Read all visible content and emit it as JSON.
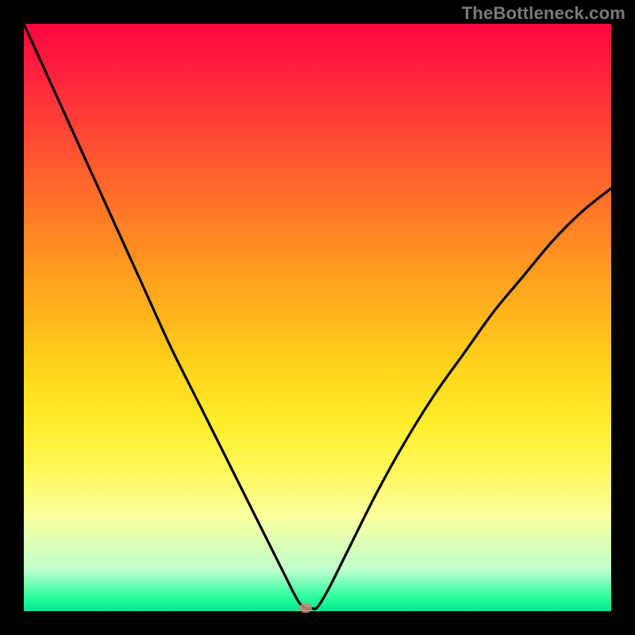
{
  "watermark": "TheBottleneck.com",
  "colors": {
    "gradient_top": "#ff0640",
    "gradient_mid": "#ffd21a",
    "gradient_bottom": "#00e88e",
    "curve": "#000000",
    "marker": "#d08878",
    "frame": "#000000"
  },
  "chart_data": {
    "type": "line",
    "title": "",
    "xlabel": "",
    "ylabel": "",
    "xlim": [
      0,
      100
    ],
    "ylim": [
      0,
      100
    ],
    "grid": false,
    "legend": false,
    "annotations": [
      {
        "name": "minimum-marker",
        "x": 48,
        "y": 0.5
      }
    ],
    "series": [
      {
        "name": "bottleneck-curve",
        "x": [
          0,
          5,
          10,
          15,
          20,
          25,
          30,
          35,
          40,
          44,
          46,
          47,
          48,
          49,
          50,
          52,
          55,
          60,
          65,
          70,
          75,
          80,
          85,
          90,
          95,
          100
        ],
        "values": [
          100,
          89,
          78,
          67,
          56,
          45,
          35,
          25,
          15,
          7,
          3,
          1.3,
          0.5,
          0.5,
          0.7,
          4,
          10,
          20,
          29,
          37,
          44,
          51,
          57,
          63,
          68,
          72
        ]
      }
    ]
  }
}
